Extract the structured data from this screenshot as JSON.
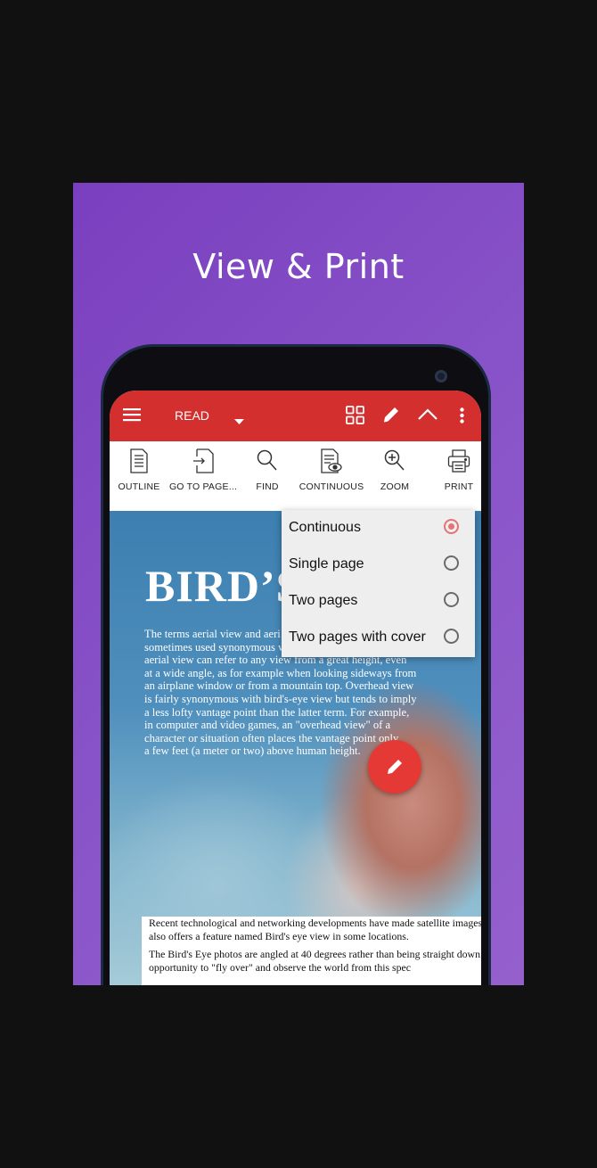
{
  "banner": {
    "title": "View & Print",
    "gradient_start": "#7a3fbf",
    "gradient_end": "#9560cc"
  },
  "appbar": {
    "color": "#d32f2f",
    "mode_label": "READ",
    "icons": [
      "menu-icon",
      "dropdown-arrow-icon",
      "grid-icon",
      "pencil-icon",
      "chevron-up-icon",
      "more-vertical-icon"
    ]
  },
  "toolbar": {
    "items": [
      {
        "label": "OUTLINE",
        "icon": "outline-icon"
      },
      {
        "label": "GO TO PAGE...",
        "icon": "go-to-page-icon"
      },
      {
        "label": "FIND",
        "icon": "search-icon"
      },
      {
        "label": "CONTINUOUS",
        "icon": "continuous-view-icon"
      },
      {
        "label": "ZOOM",
        "icon": "zoom-icon"
      },
      {
        "label": "PRINT",
        "icon": "print-icon"
      }
    ]
  },
  "document": {
    "headline": "BIRD’S",
    "body_lines": [
      "The terms aerial view and aeri",
      "sometimes used synonymous w",
      "aerial view can refer to any view from a great height, even",
      "at a wide angle, as for example when looking sideways from",
      "an airplane window or from a mountain top. Overhead view",
      "is fairly synonymous with bird's-eye view but tends to imply",
      "a less lofty vantage point than the latter term. For example,",
      "in computer and video games, an \"overhead view\" of a",
      "character or situation often places the vantage point only",
      "a few feet (a meter or two) above human height."
    ],
    "panel_p1_line1": "Recent technological and networking developments have made satellite images",
    "panel_p1_line2": "also offers a feature named Bird's eye view in some locations.",
    "panel_p2_line1": "The Bird's Eye photos are angled at 40 degrees rather than being straight down.",
    "panel_p2_line2": "opportunity to \"fly over\" and observe the world from this spec"
  },
  "view_menu": {
    "options": [
      {
        "label": "Continuous",
        "selected": true
      },
      {
        "label": "Single page",
        "selected": false
      },
      {
        "label": "Two pages",
        "selected": false
      },
      {
        "label": "Two pages with cover",
        "selected": false
      }
    ],
    "accent": "#e57373"
  },
  "fab": {
    "icon": "pencil-icon",
    "color": "#e53935"
  }
}
